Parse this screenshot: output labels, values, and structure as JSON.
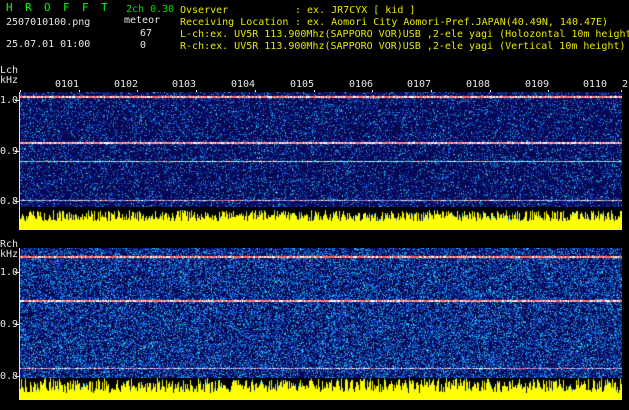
{
  "header": {
    "app_name_letters": [
      "H",
      "R",
      "O",
      "F",
      "F",
      "T"
    ],
    "filename": "250701010​0.png",
    "datetime": "25.07.01 01:00",
    "channel_info": "2ch 0.30",
    "meteor_label": "meteor",
    "count_lch": "67",
    "count_rch": "0",
    "observer_label": "Ovserver",
    "observer_value": ": ex. JR7CYX [ kid ]",
    "location_label": "Receiving Location",
    "location_value": ": ex. Aomori City Aomori-Pref.JAPAN(40.49N, 140.47E)",
    "lch_line": "L-ch:ex. UV5R 113.900Mhz(SAPPORO VOR)USB ,2-ele yagi (Holozontal 10m height",
    "rch_line": "R-ch:ex. UV5R 113.900Mhz(SAPPORO VOR)USB ,2-ele yagi (Vertical 10m height)"
  },
  "lch": {
    "label": "Lch",
    "unit": "kHz",
    "ticks": [
      "1.0",
      "0.9",
      "0.8"
    ]
  },
  "rch": {
    "label": "Rch",
    "unit": "kHz",
    "ticks": [
      "1.0",
      "0.9",
      "0.8"
    ]
  },
  "time_columns": [
    "0101",
    "0102",
    "0103",
    "0104",
    "0105",
    "0106",
    "0107",
    "0108",
    "0109",
    "0110"
  ],
  "time_trailing": "2",
  "colors": {
    "background": "#000000",
    "text_yellow": "#e8e800",
    "text_cyan": "#38d8d8",
    "logo_green": "#00ff00",
    "spectrum_bar": "#ffff00",
    "waterfall_bg": "#0a0a60"
  }
}
